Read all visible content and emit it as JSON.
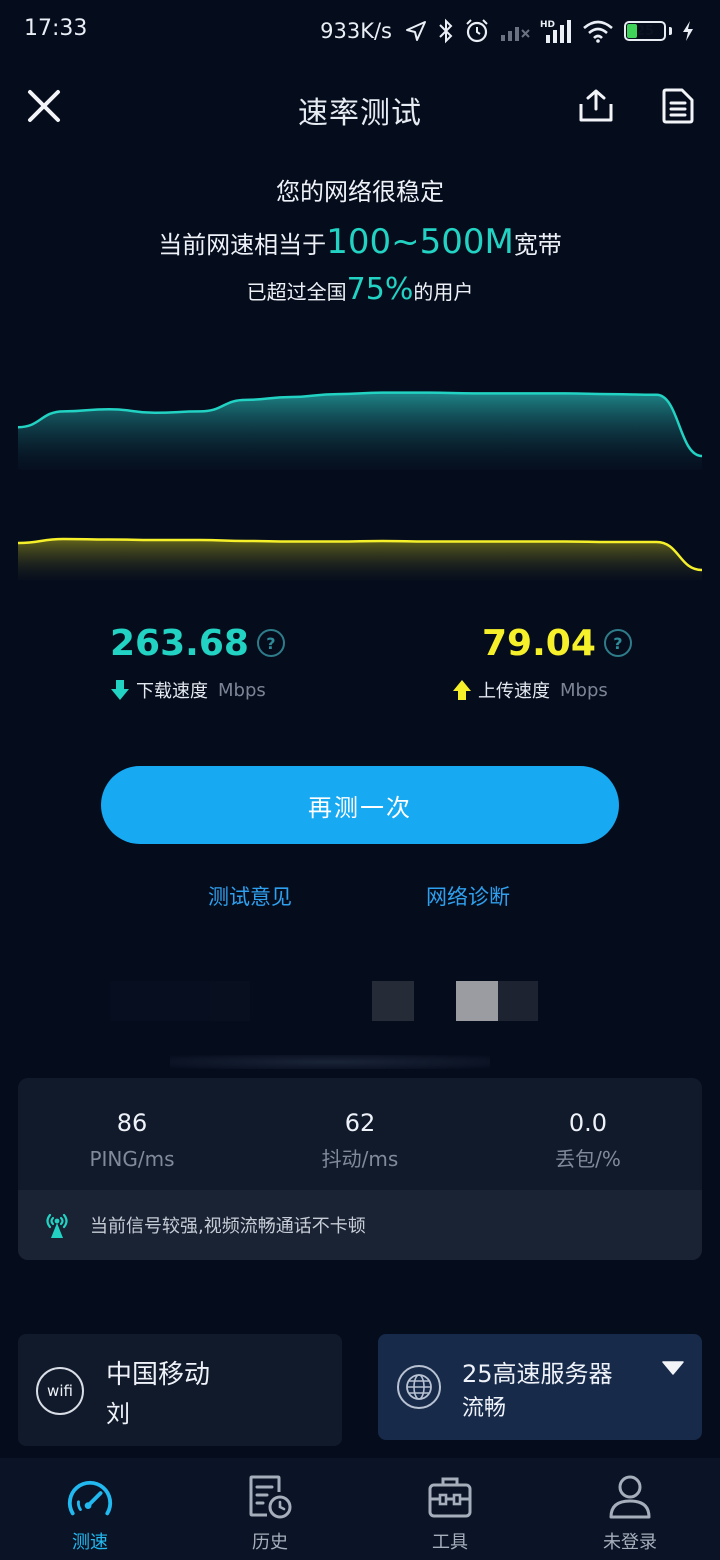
{
  "status_bar": {
    "time": "17:33",
    "net_speed": "933K/s",
    "battery_level": "25",
    "battery_fraction": 0.25
  },
  "header": {
    "title": "速率测试"
  },
  "summary": {
    "line1": "您的网络很稳定",
    "line2_prefix": "当前网速相当于",
    "line2_value": "100~500M",
    "line2_suffix": "宽带",
    "line3_prefix": "已超过全国",
    "line3_value": "75%",
    "line3_suffix": "的用户"
  },
  "chart_data": {
    "type": "area",
    "series": [
      {
        "values": [
          40,
          62,
          65,
          60,
          62,
          78,
          82,
          86,
          88,
          88,
          87,
          87,
          87,
          86,
          85,
          0
        ],
        "color": "#22d2c2"
      },
      {
        "values": [
          54,
          62,
          61,
          60,
          60,
          58,
          57,
          57,
          58,
          57,
          57,
          57,
          57,
          56,
          56,
          0
        ],
        "color": "#f6f02a"
      }
    ]
  },
  "download": {
    "value": "263.68",
    "label": "下载速度",
    "unit": "Mbps"
  },
  "upload": {
    "value": "79.04",
    "label": "上传速度",
    "unit": "Mbps"
  },
  "help_glyph": "?",
  "actions": {
    "retest": "再测一次",
    "feedback": "测试意见",
    "diagnose": "网络诊断"
  },
  "stats": [
    {
      "value": "86",
      "label": "PING/ms"
    },
    {
      "value": "62",
      "label": "抖动/ms"
    },
    {
      "value": "0.0",
      "label": "丢包/%"
    }
  ],
  "signal_message": "当前信号较强,视频流畅通话不卡顿",
  "network": {
    "icon_text": "wifi",
    "name": "中国移动",
    "user": "刘"
  },
  "server": {
    "name": "25高速服务器",
    "status": "流畅"
  },
  "nav": [
    {
      "label": "测速",
      "icon": "speedometer-icon",
      "active": true
    },
    {
      "label": "历史",
      "icon": "history-icon",
      "active": false
    },
    {
      "label": "工具",
      "icon": "toolbox-icon",
      "active": false
    },
    {
      "label": "未登录",
      "icon": "user-icon",
      "active": false
    }
  ],
  "colors": {
    "accent_teal": "#22d2c2",
    "accent_yellow": "#f6f02a",
    "button_blue": "#17aaf3",
    "link_blue": "#2fa0ee",
    "background": "#050c1c"
  }
}
